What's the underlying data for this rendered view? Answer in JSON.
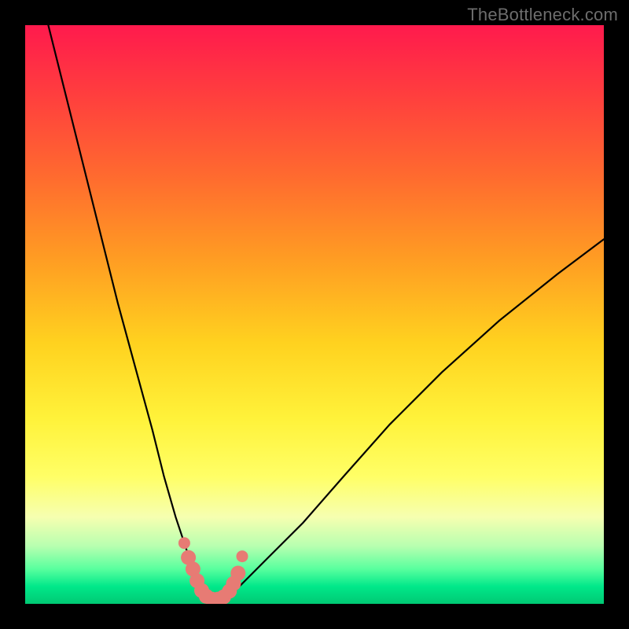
{
  "watermark": "TheBottleneck.com",
  "chart_data": {
    "type": "line",
    "title": "",
    "xlabel": "",
    "ylabel": "",
    "xlim": [
      0,
      100
    ],
    "ylim": [
      0,
      100
    ],
    "background_gradient": {
      "top": "#ff1a4d",
      "bottom": "#00c974",
      "meaning": "bottleneck severity (red=high, green=none)"
    },
    "series": [
      {
        "name": "bottleneck-curve",
        "x": [
          4,
          7,
          10,
          13,
          16,
          19,
          22,
          24,
          26,
          28,
          29,
          30,
          31,
          32,
          33,
          34,
          36,
          38,
          42,
          48,
          55,
          63,
          72,
          82,
          92,
          100
        ],
        "values": [
          100,
          88,
          76,
          64,
          52,
          41,
          30,
          22,
          15,
          9,
          6,
          3,
          1,
          0,
          0,
          1,
          2,
          4,
          8,
          14,
          22,
          31,
          40,
          49,
          57,
          63
        ]
      },
      {
        "name": "highlight-dots",
        "x": [
          27.5,
          28.2,
          29.0,
          29.7,
          30.5,
          31.3,
          32.3,
          33.3,
          34.3,
          35.3,
          36.0,
          36.8,
          37.5
        ],
        "values": [
          10.5,
          8.0,
          6.0,
          4.0,
          2.3,
          1.3,
          0.8,
          0.8,
          1.2,
          2.2,
          3.5,
          5.3,
          8.2
        ]
      }
    ],
    "minimum_at_x": 32.5
  }
}
